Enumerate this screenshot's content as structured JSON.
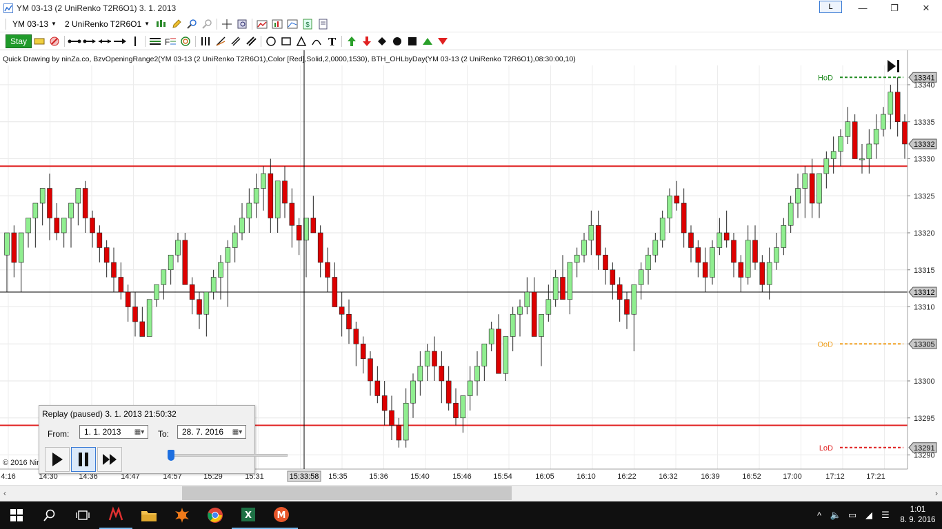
{
  "window": {
    "title": "YM 03-13 (2 UniRenko T2R6O1)  3. 1. 2013",
    "l_button": "L",
    "min_glyph": "—",
    "restore_glyph": "❐",
    "close_glyph": "✕"
  },
  "toolbar1": {
    "instrument": "YM 03-13",
    "bar_type": "2 UniRenko T2R6O1"
  },
  "toolbar2": {
    "stay_label": "Stay"
  },
  "indicator_text": "Quick Drawing by ninZa.co, BzvOpeningRange2(YM 03-13 (2 UniRenko T2R6O1),Color [Red],Solid,2,0000,1530), BTH_OHLbyDay(YM 03-13 (2 UniRenko T2R6O1),08:30:00,10)",
  "copyright": "© 2016 Nin",
  "crosshair_time": "15:33:58",
  "levels": {
    "hod_label": "HoD",
    "ood_label": "OoD",
    "lod_label": "LoD",
    "hod_color": "#1f8a1f",
    "ood_color": "#f0a020",
    "lod_color": "#e02020"
  },
  "price_badges": {
    "hod": "13341",
    "last": "13332",
    "crosshair": "13312",
    "ood": "13305",
    "lod": "13291"
  },
  "chart_data": {
    "type": "candlestick",
    "instrument": "YM 03-13",
    "up_color": "#90ee90",
    "down_color": "#dd0000",
    "y_ticks": [
      13290,
      13295,
      13300,
      13305,
      13310,
      13315,
      13320,
      13325,
      13330,
      13335,
      13340
    ],
    "ylim": [
      13288,
      13342
    ],
    "x_tick_labels": [
      "4:16",
      "14:30",
      "14:36",
      "14:47",
      "14:57",
      "15:29",
      "15:31",
      "15:33:58",
      "15:35",
      "15:36",
      "15:40",
      "15:46",
      "15:54",
      "16:05",
      "16:10",
      "16:22",
      "16:32",
      "16:39",
      "16:52",
      "17:00",
      "17:12",
      "17:21"
    ],
    "horizontal_lines": [
      {
        "price": 13329,
        "color": "#e02020"
      },
      {
        "price": 13294,
        "color": "#e02020"
      },
      {
        "price": 13312,
        "color": "#000000"
      }
    ],
    "levels": {
      "hod": 13341,
      "ood": 13305,
      "lod": 13291
    },
    "candles": [
      [
        13317,
        13320,
        13312,
        13320
      ],
      [
        13320,
        13321,
        13314,
        13316
      ],
      [
        13316,
        13320,
        13312,
        13320
      ],
      [
        13320,
        13322,
        13318,
        13322
      ],
      [
        13322,
        13324,
        13318,
        13324
      ],
      [
        13324,
        13326,
        13321,
        13326
      ],
      [
        13326,
        13328,
        13319,
        13322
      ],
      [
        13322,
        13324,
        13319,
        13320
      ],
      [
        13320,
        13322,
        13318,
        13322
      ],
      [
        13322,
        13324,
        13318,
        13324
      ],
      [
        13324,
        13326,
        13321,
        13326
      ],
      [
        13326,
        13327,
        13320,
        13322
      ],
      [
        13322,
        13323,
        13318,
        13320
      ],
      [
        13320,
        13321,
        13316,
        13318
      ],
      [
        13318,
        13319,
        13314,
        13316
      ],
      [
        13316,
        13318,
        13312,
        13314
      ],
      [
        13314,
        13316,
        13311,
        13312
      ],
      [
        13312,
        13313,
        13308,
        13310
      ],
      [
        13310,
        13312,
        13306,
        13308
      ],
      [
        13308,
        13310,
        13306,
        13306
      ],
      [
        13306,
        13311,
        13306,
        13311
      ],
      [
        13311,
        13313,
        13310,
        13313
      ],
      [
        13313,
        13315,
        13311,
        13315
      ],
      [
        13315,
        13317,
        13313,
        13317
      ],
      [
        13317,
        13320,
        13316,
        13319
      ],
      [
        13319,
        13320,
        13315,
        13313
      ],
      [
        13313,
        13314,
        13309,
        13311
      ],
      [
        13311,
        13312,
        13307,
        13309
      ],
      [
        13309,
        13312,
        13306,
        13312
      ],
      [
        13312,
        13315,
        13311,
        13314
      ],
      [
        13314,
        13317,
        13311,
        13316
      ],
      [
        13316,
        13319,
        13310,
        13318
      ],
      [
        13318,
        13321,
        13316,
        13320
      ],
      [
        13320,
        13324,
        13319,
        13322
      ],
      [
        13322,
        13326,
        13320,
        13324
      ],
      [
        13324,
        13328,
        13322,
        13326
      ],
      [
        13326,
        13329,
        13323,
        13328
      ],
      [
        13328,
        13330,
        13320,
        13322
      ],
      [
        13322,
        13324,
        13320,
        13327
      ],
      [
        13327,
        13329,
        13322,
        13324
      ],
      [
        13324,
        13326,
        13318,
        13321
      ],
      [
        13321,
        13322,
        13317,
        13319
      ],
      [
        13319,
        13322,
        13314,
        13322
      ],
      [
        13322,
        13325,
        13320,
        13320
      ],
      [
        13320,
        13321,
        13314,
        13316
      ],
      [
        13316,
        13318,
        13312,
        13314
      ],
      [
        13314,
        13316,
        13310,
        13310
      ],
      [
        13310,
        13312,
        13306,
        13309
      ],
      [
        13309,
        13311,
        13305,
        13307
      ],
      [
        13307,
        13308,
        13302,
        13305
      ],
      [
        13305,
        13306,
        13301,
        13303
      ],
      [
        13303,
        13304,
        13298,
        13300
      ],
      [
        13300,
        13302,
        13297,
        13298
      ],
      [
        13298,
        13300,
        13294,
        13296
      ],
      [
        13296,
        13298,
        13292,
        13294
      ],
      [
        13294,
        13295,
        13291,
        13292
      ],
      [
        13292,
        13299,
        13291,
        13297
      ],
      [
        13297,
        13301,
        13295,
        13300
      ],
      [
        13300,
        13304,
        13298,
        13302
      ],
      [
        13302,
        13305,
        13300,
        13304
      ],
      [
        13304,
        13306,
        13300,
        13302
      ],
      [
        13302,
        13304,
        13297,
        13300
      ],
      [
        13300,
        13302,
        13296,
        13297
      ],
      [
        13297,
        13299,
        13294,
        13295
      ],
      [
        13295,
        13298,
        13293,
        13298
      ],
      [
        13298,
        13302,
        13296,
        13300
      ],
      [
        13300,
        13304,
        13298,
        13302
      ],
      [
        13302,
        13305,
        13300,
        13305
      ],
      [
        13305,
        13308,
        13304,
        13307
      ],
      [
        13307,
        13309,
        13304,
        13301
      ],
      [
        13301,
        13304,
        13300,
        13306
      ],
      [
        13306,
        13310,
        13304,
        13309
      ],
      [
        13309,
        13311,
        13306,
        13310
      ],
      [
        13310,
        13314,
        13309,
        13312
      ],
      [
        13312,
        13314,
        13306,
        13306
      ],
      [
        13306,
        13309,
        13302,
        13309
      ],
      [
        13309,
        13313,
        13308,
        13311
      ],
      [
        13311,
        13315,
        13310,
        13314
      ],
      [
        13314,
        13317,
        13312,
        13311
      ],
      [
        13311,
        13316,
        13309,
        13316
      ],
      [
        13316,
        13318,
        13314,
        13317
      ],
      [
        13317,
        13320,
        13316,
        13319
      ],
      [
        13319,
        13323,
        13317,
        13321
      ],
      [
        13321,
        13323,
        13315,
        13317
      ],
      [
        13317,
        13318,
        13313,
        13315
      ],
      [
        13315,
        13316,
        13311,
        13313
      ],
      [
        13313,
        13314,
        13308,
        13311
      ],
      [
        13311,
        13312,
        13307,
        13309
      ],
      [
        13309,
        13313,
        13304,
        13313
      ],
      [
        13313,
        13316,
        13311,
        13315
      ],
      [
        13315,
        13318,
        13313,
        13317
      ],
      [
        13317,
        13320,
        13316,
        13319
      ],
      [
        13319,
        13323,
        13318,
        13322
      ],
      [
        13322,
        13326,
        13320,
        13325
      ],
      [
        13325,
        13327,
        13323,
        13324
      ],
      [
        13324,
        13326,
        13318,
        13320
      ],
      [
        13320,
        13321,
        13316,
        13318
      ],
      [
        13318,
        13319,
        13314,
        13316
      ],
      [
        13316,
        13318,
        13312,
        13314
      ],
      [
        13314,
        13319,
        13313,
        13318
      ],
      [
        13318,
        13322,
        13317,
        13320
      ],
      [
        13320,
        13323,
        13318,
        13319
      ],
      [
        13319,
        13320,
        13314,
        13316
      ],
      [
        13316,
        13317,
        13312,
        13314
      ],
      [
        13314,
        13321,
        13313,
        13319
      ],
      [
        13319,
        13321,
        13315,
        13316
      ],
      [
        13316,
        13317,
        13312,
        13313
      ],
      [
        13313,
        13318,
        13311,
        13316
      ],
      [
        13316,
        13320,
        13315,
        13318
      ],
      [
        13318,
        13322,
        13317,
        13321
      ],
      [
        13321,
        13325,
        13320,
        13324
      ],
      [
        13324,
        13328,
        13322,
        13326
      ],
      [
        13326,
        13329,
        13322,
        13328
      ],
      [
        13328,
        13330,
        13322,
        13324
      ],
      [
        13324,
        13328,
        13322,
        13328
      ],
      [
        13328,
        13331,
        13326,
        13330
      ],
      [
        13330,
        13333,
        13328,
        13331
      ],
      [
        13331,
        13334,
        13329,
        13333
      ],
      [
        13333,
        13337,
        13332,
        13335
      ],
      [
        13335,
        13336,
        13330,
        13330
      ],
      [
        13330,
        13332,
        13328,
        13330
      ],
      [
        13330,
        13334,
        13328,
        13332
      ],
      [
        13332,
        13336,
        13330,
        13334
      ],
      [
        13334,
        13337,
        13333,
        13336
      ],
      [
        13336,
        13340,
        13334,
        13339
      ],
      [
        13339,
        13341,
        13333,
        13335
      ],
      [
        13335,
        13336,
        13330,
        13332
      ]
    ]
  }
}
